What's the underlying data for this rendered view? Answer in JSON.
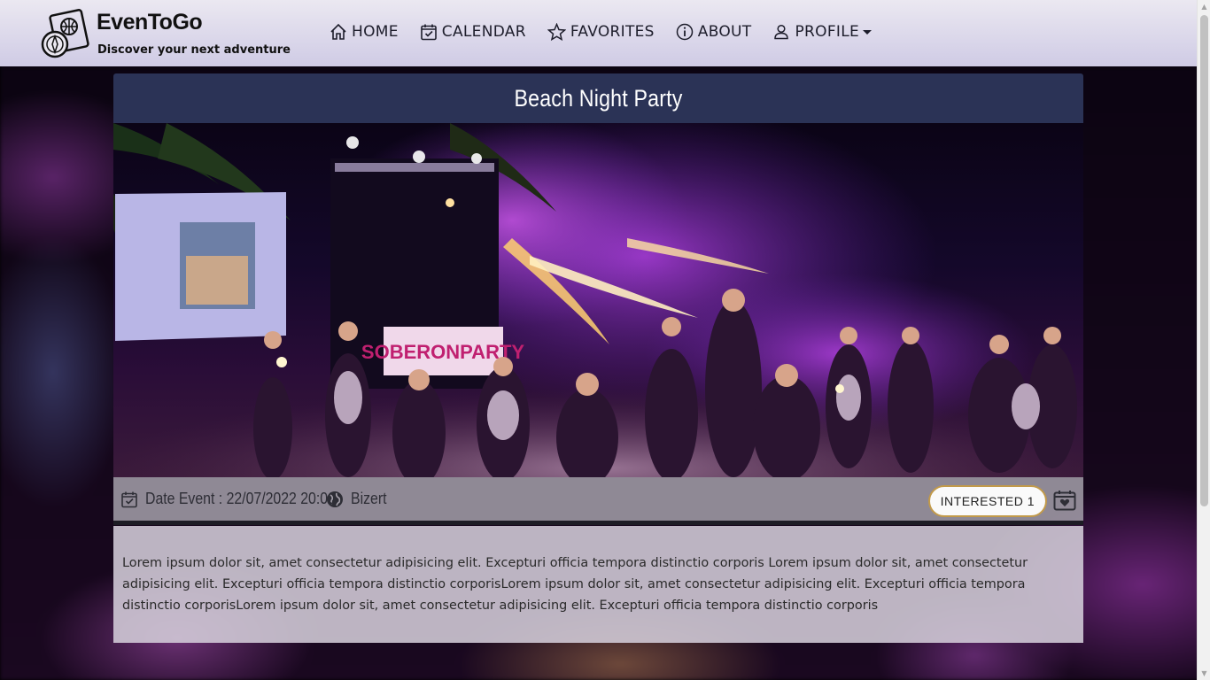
{
  "brand": {
    "name": "EvenToGo",
    "tagline": "Discover your next adventure"
  },
  "nav": {
    "items": [
      {
        "label": "HOME",
        "icon": "home-icon"
      },
      {
        "label": "CALENDAR",
        "icon": "calendar-check-icon"
      },
      {
        "label": "FAVORITES",
        "icon": "star-icon"
      },
      {
        "label": "ABOUT",
        "icon": "info-icon"
      },
      {
        "label": "PROFILE",
        "icon": "user-icon"
      }
    ]
  },
  "event": {
    "title": "Beach Night Party",
    "image_text": "SOBERONPARTY",
    "date_label": "Date Event : 22/07/2022 20:00",
    "location": "Bizert",
    "interested_label": "INTERESTED 1",
    "description": "Lorem ipsum dolor sit, amet consectetur adipisicing elit. Excepturi officia tempora distinctio corporis Lorem ipsum dolor sit, amet consectetur adipisicing elit. Excepturi officia tempora distinctio corporisLorem ipsum dolor sit, amet consectetur adipisicing elit. Excepturi officia tempora distinctio corporisLorem ipsum dolor sit, amet consectetur adipisicing elit. Excepturi officia tempora distinctio corporis"
  },
  "colors": {
    "navbar": "#d9d5ea",
    "card_header": "#2b3356",
    "button_border": "#c29a4a"
  }
}
